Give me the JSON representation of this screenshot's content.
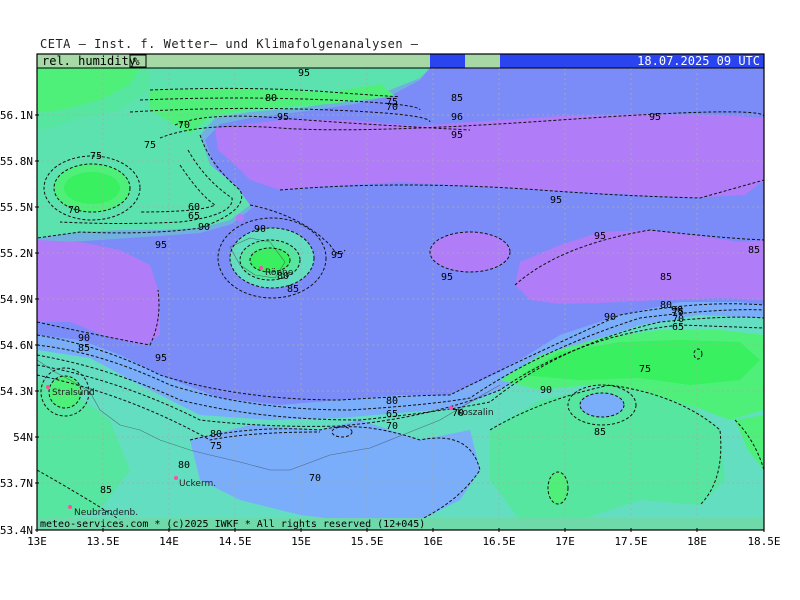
{
  "header": {
    "title": "CETA — Inst. f. Wetter— und Klimafolgenanalysen —"
  },
  "banner": {
    "field_label": "rel. humidity",
    "unit": "%",
    "timestamp": "18.07.2025 09 UTC"
  },
  "footer": {
    "credit": "meteo-services.com * (c)2025 IWKF * All rights reserved (12+045)"
  },
  "axes": {
    "lat_labels": [
      "56.1N",
      "55.8N",
      "55.5N",
      "55.2N",
      "54.9N",
      "54.6N",
      "54.3N",
      "54N",
      "53.7N",
      "53.4N"
    ],
    "lon_labels": [
      "13E",
      "13.5E",
      "14E",
      "14.5E",
      "15E",
      "15.5E",
      "16E",
      "16.5E",
      "17E",
      "17.5E",
      "18E",
      "18.5E"
    ]
  },
  "places": [
    {
      "name": "Stralsund"
    },
    {
      "name": "Rönne"
    },
    {
      "name": "Koszalin"
    },
    {
      "name": "Uckerm."
    },
    {
      "name": "Neubrandenb."
    }
  ],
  "contour_labels": [
    "95",
    "80",
    "70",
    "75",
    "85",
    "96",
    "95",
    "95",
    "70",
    "75",
    "75",
    "70",
    "60",
    "65",
    "90",
    "95",
    "90",
    "80",
    "85",
    "95",
    "95",
    "95",
    "95",
    "95",
    "85",
    "80",
    "75",
    "70",
    "65",
    "90",
    "90",
    "85",
    "95",
    "90",
    "85",
    "80",
    "65",
    "70",
    "70",
    "75",
    "90",
    "85",
    "80",
    "75",
    "80",
    "85",
    "70"
  ],
  "colors": {
    "humidity_95_plus": "#b07cf7",
    "humidity_90": "#7b8cf9",
    "humidity_85": "#7aaefa",
    "humidity_80": "#64dec0",
    "humidity_75": "#56e6a0",
    "humidity_70": "#4ef07a",
    "humidity_65": "#38f060",
    "frame": "#000000",
    "grid": "#aaaaaa"
  }
}
